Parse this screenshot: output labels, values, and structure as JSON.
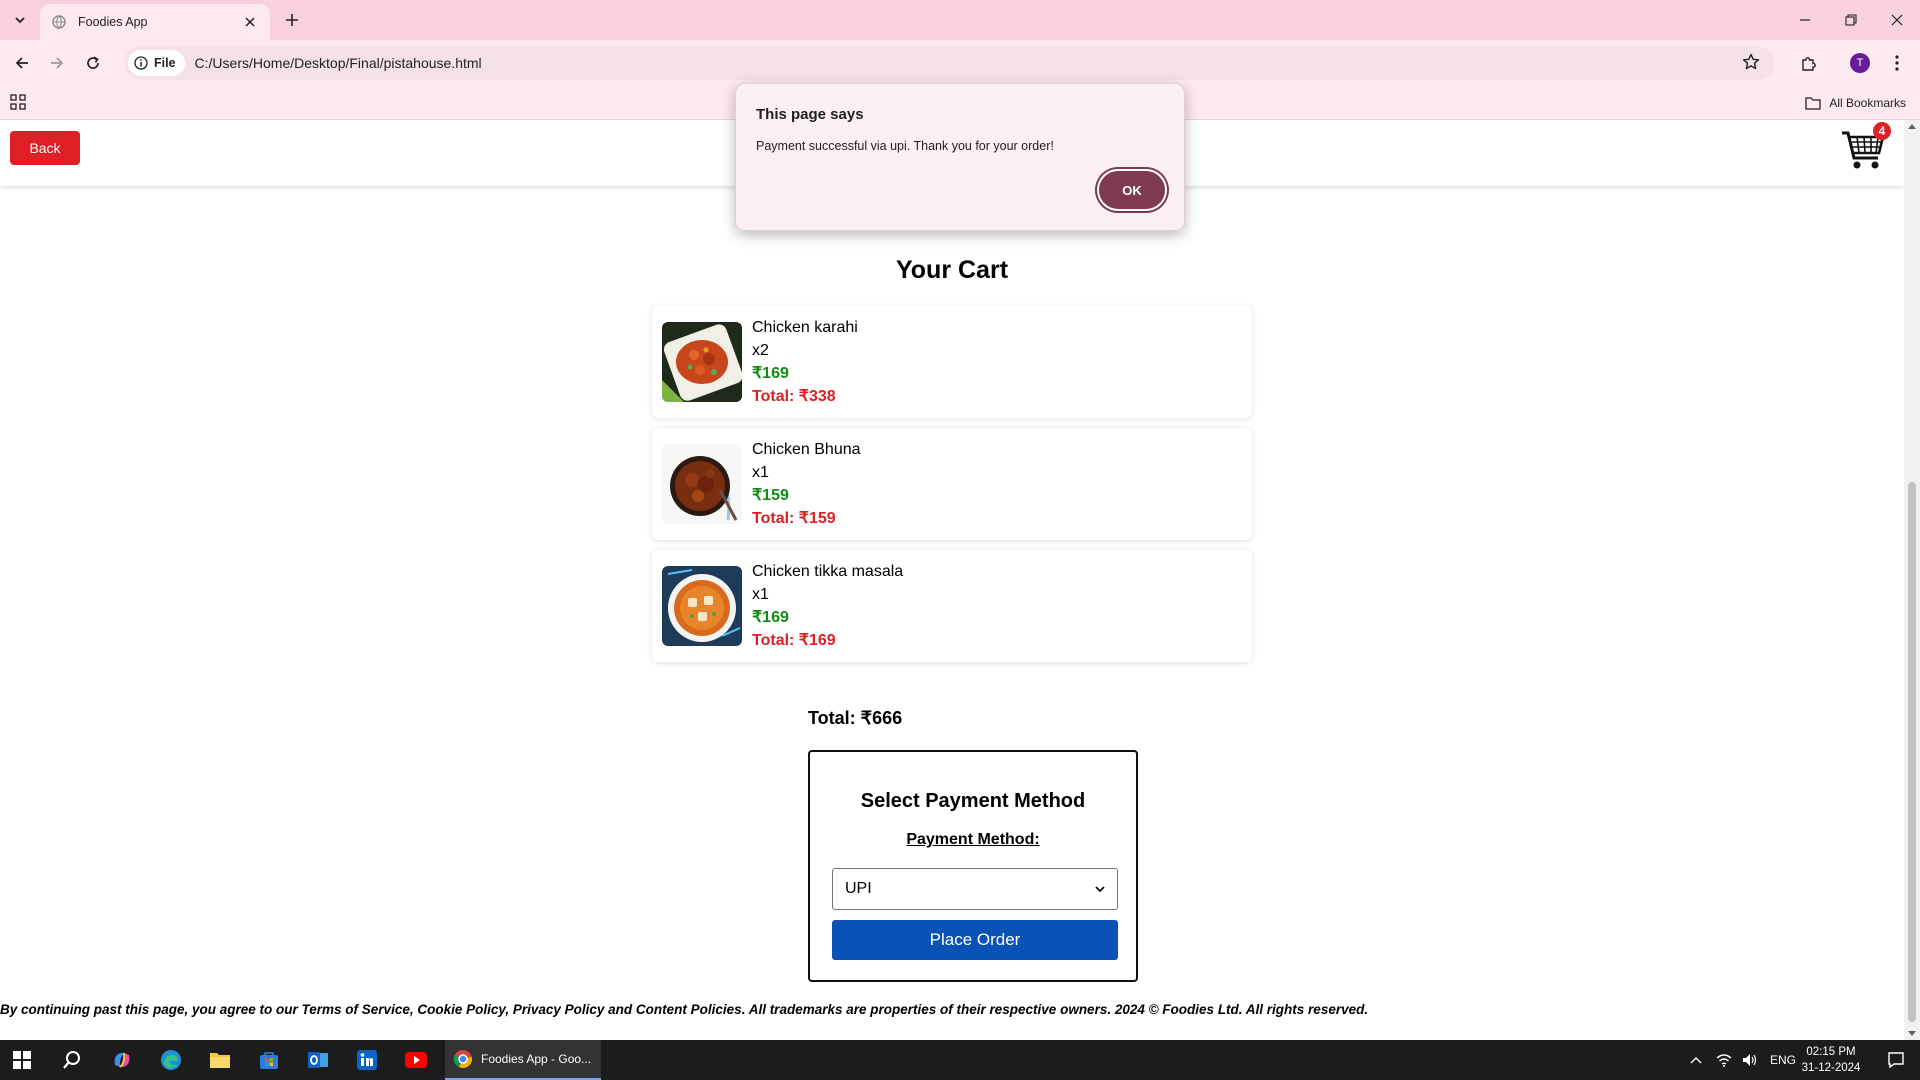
{
  "browser": {
    "tab_title": "Foodies App",
    "address_chip": "File",
    "url": "C:/Users/Home/Desktop/Final/pistahouse.html",
    "bookmarks_label": "All Bookmarks",
    "profile_initial": "T"
  },
  "header": {
    "back_label": "Back",
    "cart_count": "4"
  },
  "cart": {
    "title": "Your Cart",
    "items": [
      {
        "name": "Chicken karahi",
        "qty": "x2",
        "price": "₹169",
        "total": "Total: ₹338"
      },
      {
        "name": "Chicken Bhuna",
        "qty": "x1",
        "price": "₹159",
        "total": "Total: ₹159"
      },
      {
        "name": "Chicken tikka masala",
        "qty": "x1",
        "price": "₹169",
        "total": "Total: ₹169"
      }
    ],
    "grand_total": "Total: ₹666"
  },
  "payment": {
    "title": "Select Payment Method",
    "label": "Payment Method:",
    "selected": "UPI",
    "place_order_label": "Place Order"
  },
  "footer": {
    "text": "By continuing past this page, you agree to our Terms of Service, Cookie Policy, Privacy Policy and Content Policies. All trademarks are properties of their respective owners. 2024 © Foodies Ltd. All rights reserved."
  },
  "dialog": {
    "title": "This page says",
    "message": "Payment successful via upi. Thank you for your order!",
    "ok_label": "OK"
  },
  "taskbar": {
    "active_task": "Foodies App - Goo...",
    "language": "ENG",
    "time": "02:15 PM",
    "date": "31-12-2024"
  },
  "colors": {
    "accent_red": "#e01e26",
    "price_green": "#118c11",
    "button_blue": "#0a52b5",
    "dialog_ok": "#7d3a52",
    "chrome_pink": "#f9d1dc"
  }
}
